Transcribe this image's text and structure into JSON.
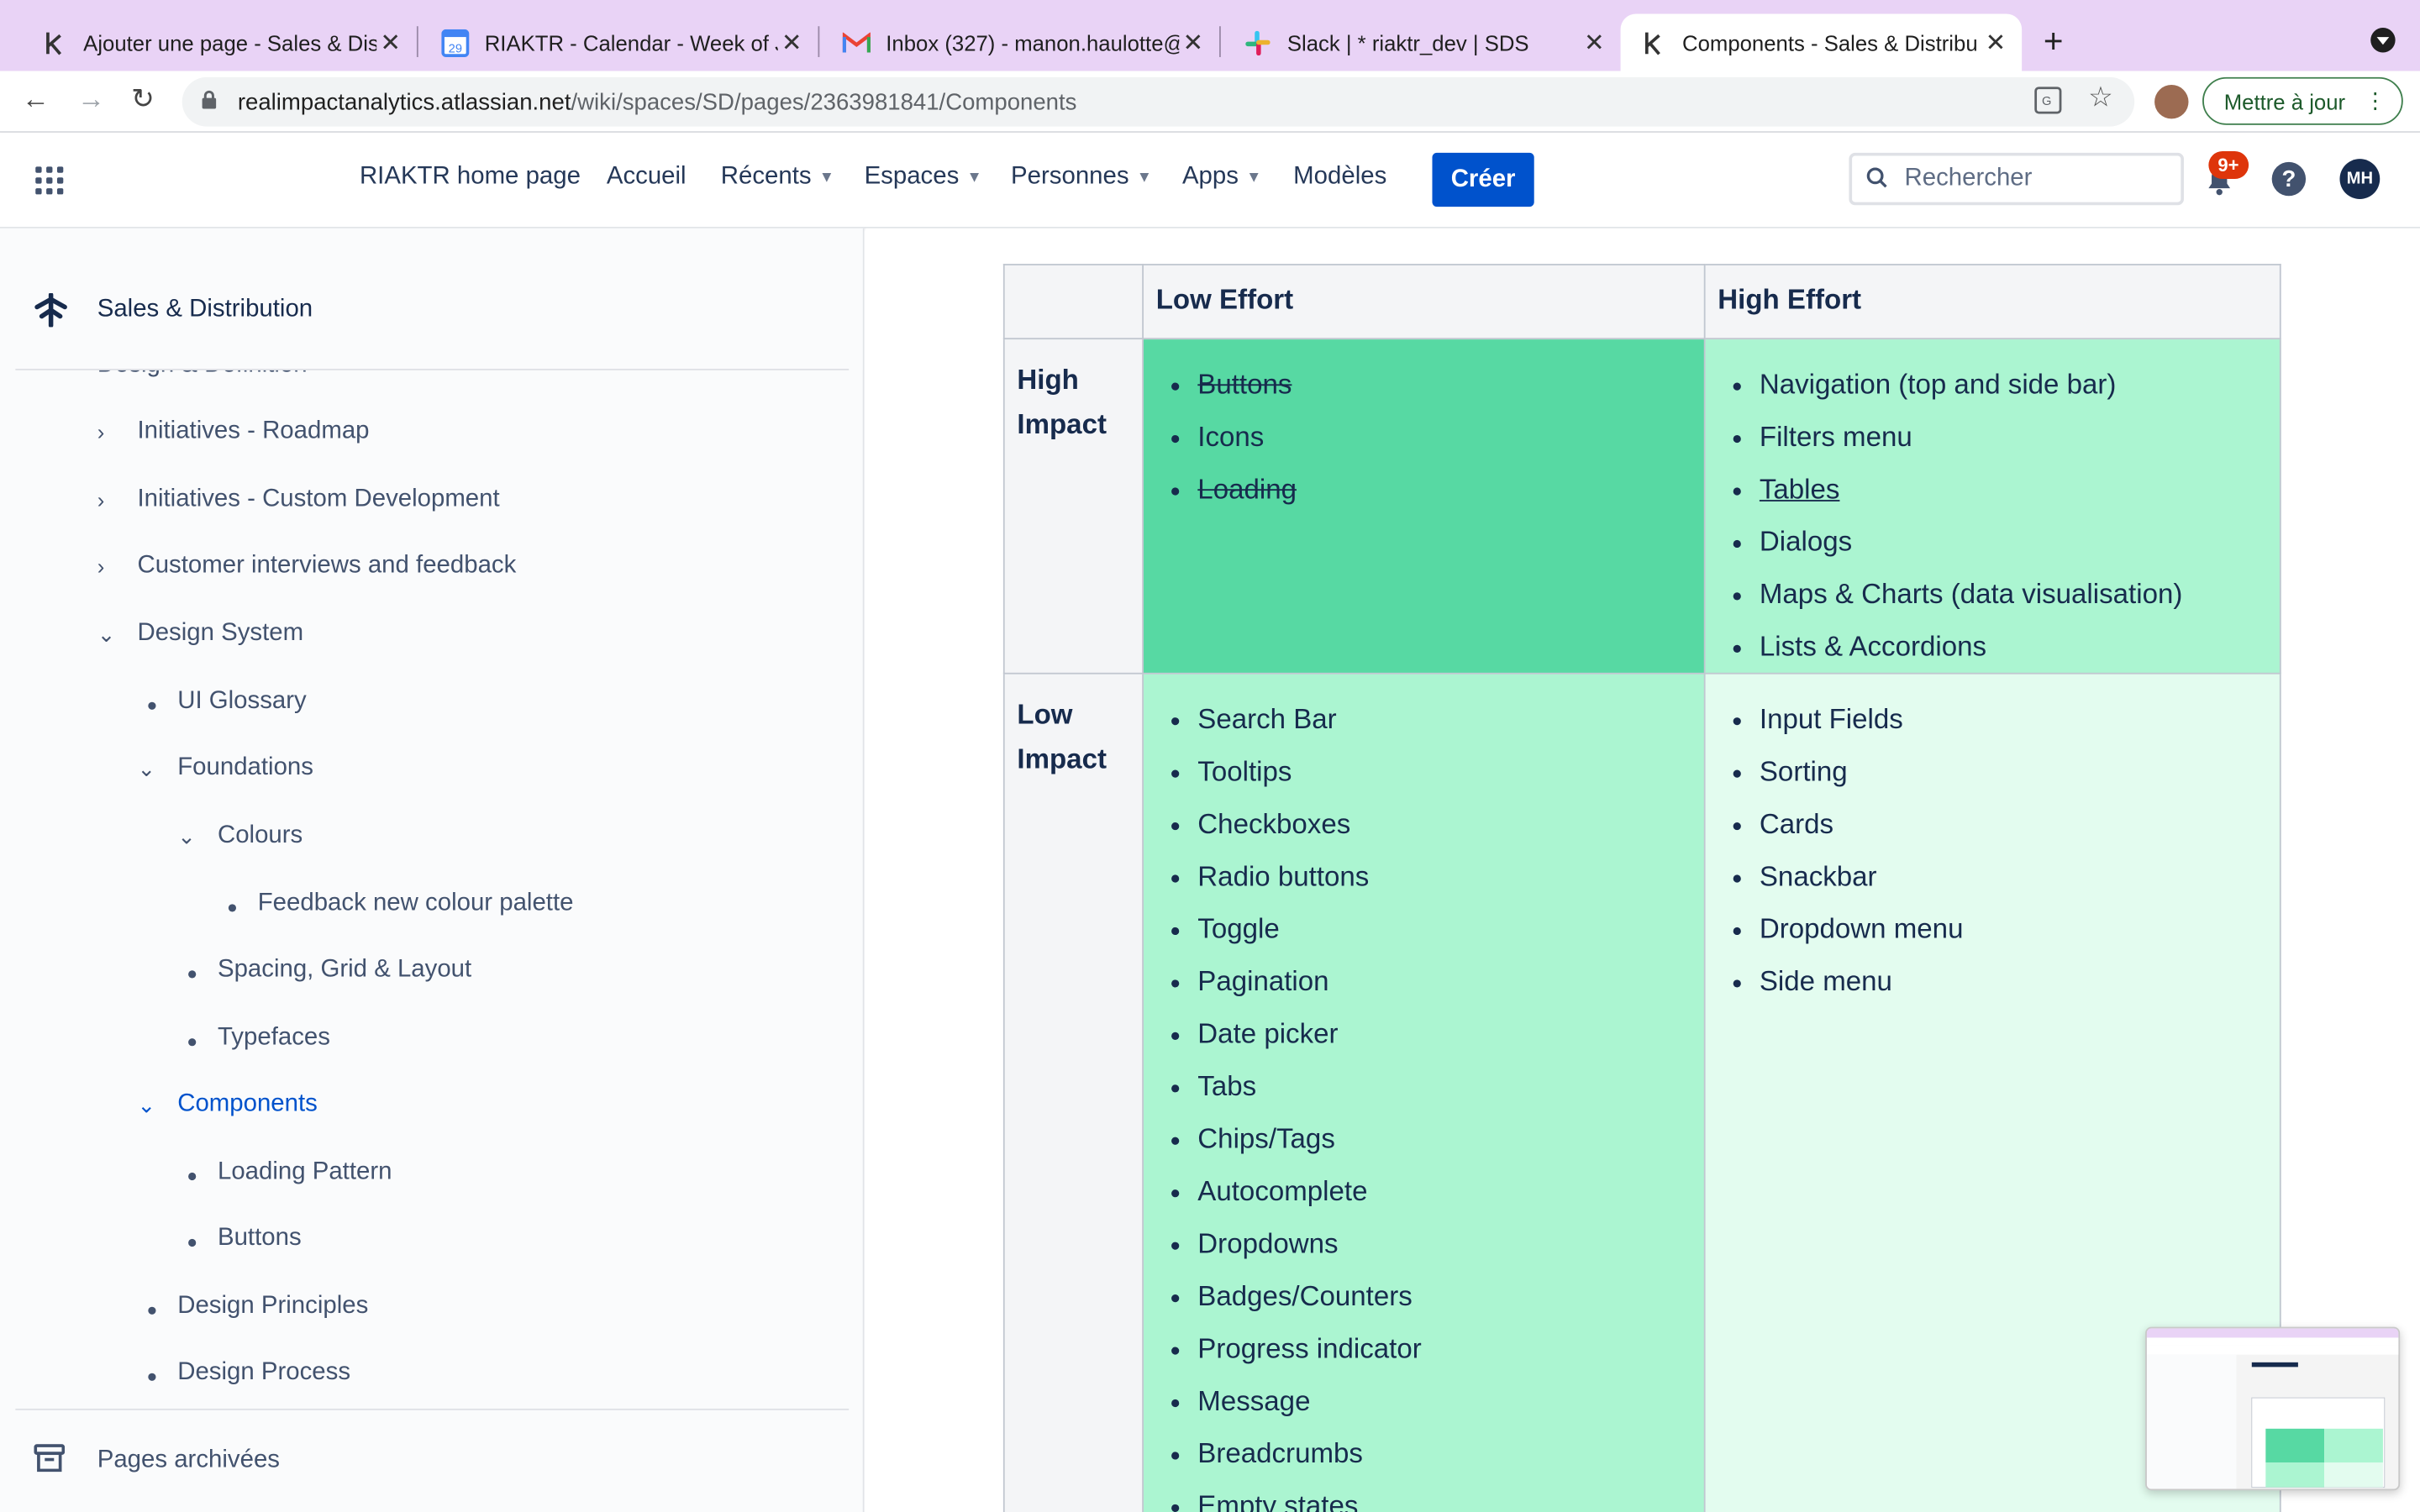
{
  "browser": {
    "tabs": [
      {
        "title": "Ajouter une page - Sales & Dis",
        "icon": "confluence-icon"
      },
      {
        "title": "RIAKTR - Calendar - Week of J",
        "icon": "google-calendar-icon"
      },
      {
        "title": "Inbox (327) - manon.haulotte@",
        "icon": "gmail-icon"
      },
      {
        "title": "Slack | * riaktr_dev | SDS",
        "icon": "slack-icon"
      },
      {
        "title": "Components - Sales & Distribu",
        "icon": "confluence-icon"
      }
    ],
    "active_tab": 4,
    "url_host": "realimpactanalytics.atlassian.net",
    "url_path": "/wiki/spaces/SD/pages/2363981841/Components",
    "update_label": "Mettre à jour"
  },
  "appnav": {
    "home": "RIAKTR home page",
    "accueil": "Accueil",
    "recents": "Récents",
    "espaces": "Espaces",
    "personnes": "Personnes",
    "apps": "Apps",
    "modeles": "Modèles",
    "create": "Créer",
    "search_placeholder": "Rechercher",
    "notif_badge": "9+",
    "avatar_initials": "MH"
  },
  "sidebar": {
    "space_name": "Sales & Distribution",
    "cut_item": "Design & Definition",
    "items": [
      {
        "label": "Initiatives - Roadmap",
        "marker": "chevron-right"
      },
      {
        "label": "Initiatives - Custom Development",
        "marker": "chevron-right"
      },
      {
        "label": "Customer interviews and feedback",
        "marker": "chevron-right"
      },
      {
        "label": "Design System",
        "marker": "chevron-down"
      },
      {
        "label": "UI Glossary",
        "marker": "bullet"
      },
      {
        "label": "Foundations",
        "marker": "chevron-down"
      },
      {
        "label": "Colours",
        "marker": "chevron-down"
      },
      {
        "label": "Feedback new colour palette",
        "marker": "bullet"
      },
      {
        "label": "Spacing, Grid & Layout",
        "marker": "bullet"
      },
      {
        "label": "Typefaces",
        "marker": "bullet"
      },
      {
        "label": "Components",
        "marker": "chevron-down",
        "current": true
      },
      {
        "label": "Loading Pattern",
        "marker": "bullet"
      },
      {
        "label": "Buttons",
        "marker": "bullet"
      },
      {
        "label": "Design Principles",
        "marker": "bullet"
      },
      {
        "label": "Design Process",
        "marker": "bullet"
      }
    ],
    "archived_label": "Pages archivées"
  },
  "matrix": {
    "col_low_effort": "Low Effort",
    "col_high_effort": "High Effort",
    "row_high_impact": "High Impact",
    "row_low_impact": "Low Impact",
    "high_impact_low_effort": [
      {
        "text": "Buttons",
        "style": "strike"
      },
      {
        "text": "Icons",
        "style": "normal"
      },
      {
        "text": "Loading ",
        "style": "strike"
      }
    ],
    "high_impact_high_effort": [
      {
        "text": "Navigation (top and side bar)",
        "style": "normal"
      },
      {
        "text": "Filters menu",
        "style": "normal"
      },
      {
        "text": "Tables",
        "style": "underline"
      },
      {
        "text": "Dialogs",
        "style": "normal"
      },
      {
        "text": "Maps & Charts (data visualisation)",
        "style": "normal"
      },
      {
        "text": "Lists & Accordions",
        "style": "normal"
      }
    ],
    "low_impact_low_effort": [
      {
        "text": "Search Bar",
        "style": "normal"
      },
      {
        "text": "Tooltips",
        "style": "normal"
      },
      {
        "text": "Checkboxes",
        "style": "normal"
      },
      {
        "text": "Radio buttons",
        "style": "normal"
      },
      {
        "text": "Toggle",
        "style": "normal"
      },
      {
        "text": "Pagination",
        "style": "normal"
      },
      {
        "text": "Date picker",
        "style": "normal"
      },
      {
        "text": "Tabs",
        "style": "normal"
      },
      {
        "text": "Chips/Tags",
        "style": "normal"
      },
      {
        "text": "Autocomplete",
        "style": "normal"
      },
      {
        "text": "Dropdowns",
        "style": "normal"
      },
      {
        "text": "Badges/Counters",
        "style": "normal"
      },
      {
        "text": "Progress indicator",
        "style": "normal"
      },
      {
        "text": "Message",
        "style": "normal"
      },
      {
        "text": "Breadcrumbs",
        "style": "normal"
      },
      {
        "text": "Empty states",
        "style": "normal"
      }
    ],
    "low_impact_high_effort": [
      {
        "text": "Input Fields",
        "style": "normal"
      },
      {
        "text": "Sorting",
        "style": "normal"
      },
      {
        "text": "Cards",
        "style": "normal"
      },
      {
        "text": "Snackbar",
        "style": "normal"
      },
      {
        "text": "Dropdown menu",
        "style": "normal"
      },
      {
        "text": "Side menu",
        "style": "normal"
      }
    ]
  },
  "colors": {
    "accent": "#0052cc",
    "tab_strip": "#e9d3f6",
    "cell_strong_green": "#57d9a3",
    "cell_mid_green": "#abf5d1",
    "cell_light_green": "#e3fcef",
    "badge_red": "#de350b"
  }
}
